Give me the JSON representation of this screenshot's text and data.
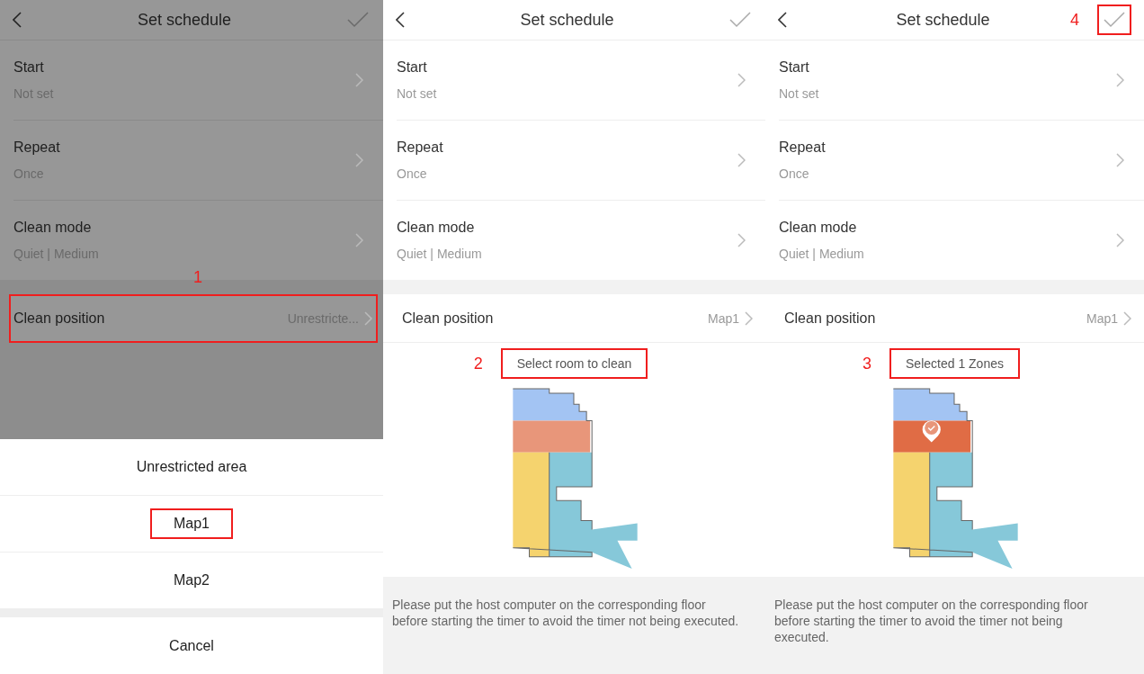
{
  "screens": [
    {
      "dimmed": true,
      "header": {
        "title": "Set schedule",
        "confirm": {
          "highlighted": false
        }
      },
      "settings": [
        {
          "label": "Start",
          "value": "Not set"
        },
        {
          "label": "Repeat",
          "value": "Once"
        },
        {
          "label": "Clean mode",
          "value": "Quiet | Medium"
        }
      ],
      "position": {
        "label": "Clean position",
        "value": "Unrestricte...",
        "highlighted": true,
        "step": "1"
      },
      "sheet": {
        "options": [
          {
            "label": "Unrestricted area",
            "highlighted": false
          },
          {
            "label": "Map1",
            "highlighted": true
          },
          {
            "label": "Map2",
            "highlighted": false
          }
        ],
        "cancel": "Cancel"
      }
    },
    {
      "dimmed": false,
      "header": {
        "title": "Set schedule",
        "confirm": {
          "highlighted": false
        }
      },
      "settings": [
        {
          "label": "Start",
          "value": "Not set"
        },
        {
          "label": "Repeat",
          "value": "Once"
        },
        {
          "label": "Clean mode",
          "value": "Quiet | Medium"
        }
      ],
      "position": {
        "label": "Clean position",
        "value": "Map1",
        "highlighted": false
      },
      "map": {
        "prompt": "Select room to clean",
        "prompt_highlighted": true,
        "step": "2",
        "rooms": [
          {
            "color": "#a3c4f3",
            "selected": false
          },
          {
            "color": "#e8967a",
            "selected": false
          },
          {
            "color": "#f5d36e",
            "selected": false
          },
          {
            "color": "#86c8d9",
            "selected": false
          }
        ]
      },
      "note": "Please put the host computer on the corresponding floor before starting the timer to avoid the timer not being executed."
    },
    {
      "dimmed": false,
      "header": {
        "title": "Set schedule",
        "confirm": {
          "highlighted": true,
          "step": "4"
        }
      },
      "settings": [
        {
          "label": "Start",
          "value": "Not set"
        },
        {
          "label": "Repeat",
          "value": "Once"
        },
        {
          "label": "Clean mode",
          "value": "Quiet | Medium"
        }
      ],
      "position": {
        "label": "Clean position",
        "value": "Map1",
        "highlighted": false
      },
      "map": {
        "prompt": "Selected 1 Zones",
        "prompt_highlighted": true,
        "step": "3",
        "rooms": [
          {
            "color": "#a3c4f3",
            "selected": false
          },
          {
            "color": "#e06c45",
            "selected": true
          },
          {
            "color": "#f5d36e",
            "selected": false
          },
          {
            "color": "#86c8d9",
            "selected": false
          }
        ]
      },
      "note": "Please put the host computer on the corresponding floor before starting the timer to avoid the timer not being executed."
    }
  ]
}
